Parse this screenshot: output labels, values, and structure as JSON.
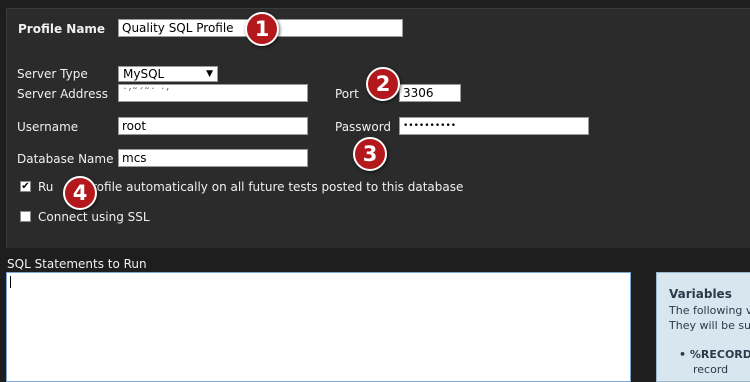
{
  "profile": {
    "label": "Profile Name",
    "value": "Quality SQL Profile"
  },
  "server_type": {
    "label": "Server Type",
    "value": "MySQL"
  },
  "server_address": {
    "label": "Server Address",
    "value": "˙’˜´˜˙ ˙’"
  },
  "port": {
    "label": "Port",
    "value": "3306"
  },
  "username": {
    "label": "Username",
    "value": "root"
  },
  "password": {
    "label": "Password",
    "value": "••••••••••"
  },
  "database": {
    "label": "Database Name",
    "value": "mcs"
  },
  "run_auto": {
    "label_start": "Ru",
    "label_end": "rofile automatically on all future tests posted to this database",
    "checked": true
  },
  "ssl": {
    "label": "Connect using SSL",
    "checked": false
  },
  "sql": {
    "label": "SQL Statements to Run",
    "value": ""
  },
  "variables": {
    "title": "Variables",
    "line1": "The following v",
    "line2": "They will be su",
    "bullet": "%RECORD",
    "bullet_cont": "record"
  },
  "badges": [
    "1",
    "2",
    "3",
    "4"
  ],
  "colors": {
    "badge_red": "#b3191c",
    "panel_bg": "#2b2b2b",
    "page_bg": "#1e1e1e",
    "info_box": "#d8e6ef"
  },
  "icons": {
    "select_arrow": "chevron-down-icon",
    "check": "checkmark-icon"
  }
}
